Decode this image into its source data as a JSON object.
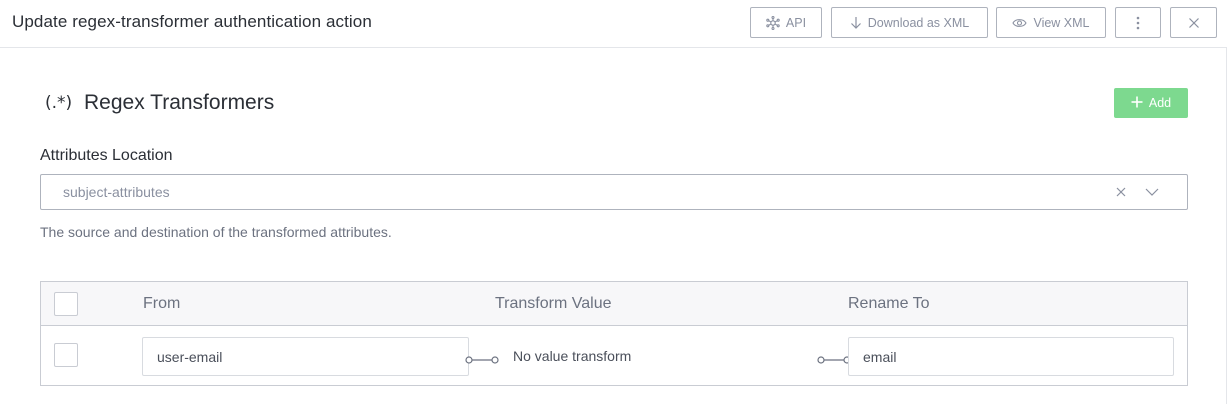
{
  "header": {
    "title": "Update regex-transformer authentication action",
    "buttons": {
      "api": "API",
      "download_xml": "Download as XML",
      "view_xml": "View XML"
    },
    "icons": {
      "api": "api-network-icon",
      "download": "download-arrow-icon",
      "view": "eye-icon",
      "more": "more-vertical-icon",
      "close": "close-icon"
    }
  },
  "section": {
    "icon_text": "(.*)",
    "title": "Regex Transformers",
    "add_label": "Add"
  },
  "attributes_location": {
    "label": "Attributes Location",
    "value": "subject-attributes",
    "help_text": "The source and destination of the transformed attributes."
  },
  "table": {
    "columns": [
      "From",
      "Transform Value",
      "Rename To"
    ],
    "rows": [
      {
        "from": "user-email",
        "transform": "No value transform",
        "rename_to": "email",
        "checked": false
      }
    ]
  },
  "colors": {
    "add_button": "#7dd98f",
    "border": "#aeb3bd",
    "muted_text": "#8a90a0",
    "header_bg": "#f7f7f9"
  }
}
